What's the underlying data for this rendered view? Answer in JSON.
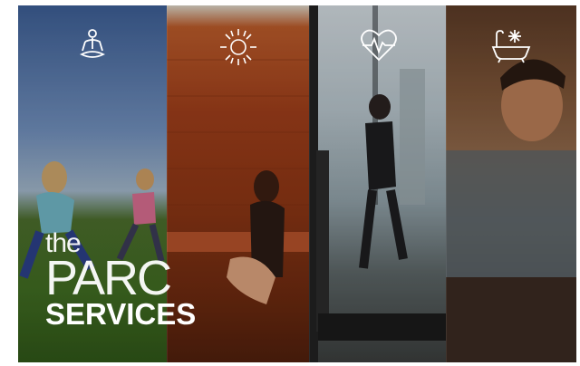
{
  "logo": {
    "line1": "the",
    "line2": "PARC",
    "line3": "SERVICES"
  },
  "panels": [
    {
      "icon": "meditation-icon"
    },
    {
      "icon": "sun-icon"
    },
    {
      "icon": "heartbeat-icon"
    },
    {
      "icon": "ice-bath-icon"
    }
  ],
  "colors": {
    "icon": "#ffffff",
    "logo": "#ffffff"
  }
}
